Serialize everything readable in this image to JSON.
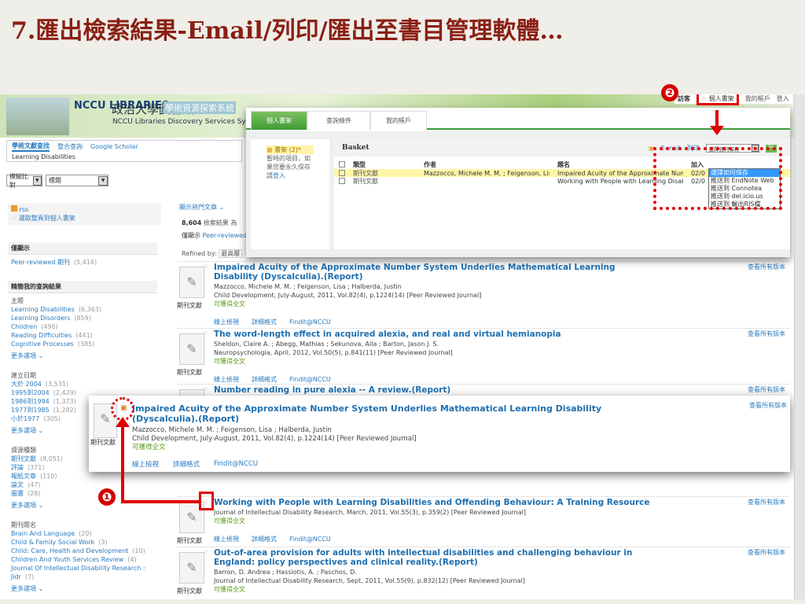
{
  "slide_title": "7.匯出檢索結果-Email/列印/匯出至書目管理軟體…",
  "header": {
    "logo": "NCCU LIBRARIES",
    "title_zh": "政治大學圖書館",
    "title_tag": "學術資源探索系統",
    "title_en": "NCCU Libraries Discovery Services System",
    "user_label": "訪客",
    "basket_link": "個人書架",
    "account_link": "我的帳戶",
    "login_link": "登入"
  },
  "search": {
    "tabs": [
      "學術文獻查找",
      "整合查詢",
      "Google Scholar"
    ],
    "query": "Learning Disabilities",
    "match_select": "模糊比對",
    "field_select": "標題"
  },
  "sidebar": {
    "rss": "rss",
    "save_page": "選取整頁到個人書架",
    "only_show_heading": "僅顯示",
    "peer_reviewed": {
      "label": "Peer-reviewed 期刊",
      "count": "(5,416)"
    },
    "refine_heading": "精簡我的查詢結果",
    "groups": [
      {
        "title": "主題",
        "items": [
          {
            "label": "Learning Disabilities",
            "count": "(6,363)"
          },
          {
            "label": "Learning Disorders",
            "count": "(859)"
          },
          {
            "label": "Children",
            "count": "(490)"
          },
          {
            "label": "Reading Difficulties",
            "count": "(441)"
          },
          {
            "label": "Cognitive Processes",
            "count": "(385)"
          }
        ],
        "more": "更多選項 ⌄"
      },
      {
        "title": "建立日期",
        "items": [
          {
            "label": "大於 2004",
            "count": "(3,531)"
          },
          {
            "label": "1995到2004",
            "count": "(2,429)"
          },
          {
            "label": "1986到1994",
            "count": "(1,373)"
          },
          {
            "label": "1977到1985",
            "count": "(1,282)"
          },
          {
            "label": "小於1977",
            "count": "(305)"
          }
        ],
        "more": "更多選項 ⌄"
      },
      {
        "title": "資源種類",
        "items": [
          {
            "label": "期刊文獻",
            "count": "(8,051)"
          },
          {
            "label": "評論",
            "count": "(371)"
          },
          {
            "label": "報紙文章",
            "count": "(110)"
          },
          {
            "label": "論文",
            "count": "(47)"
          },
          {
            "label": "圖書",
            "count": "(28)"
          }
        ],
        "more": "更多選項 ⌄"
      },
      {
        "title": "期刊題名",
        "items": [
          {
            "label": "Brain And Language",
            "count": "(20)"
          },
          {
            "label": "Child & Family Social Work",
            "count": "(3)"
          },
          {
            "label": "Child: Care, Health and Development",
            "count": "(10)"
          },
          {
            "label": "Children And Youth Services Review",
            "count": "(4)"
          },
          {
            "label": "Journal Of Intellectual Disability Research : Jidr",
            "count": "(7)"
          }
        ],
        "more": "更多選項 ⌄"
      }
    ]
  },
  "results_header": {
    "popular": "顯示熱門文章 ⌄",
    "count": "8,604",
    "count_label": "檢索結果 為",
    "only_show": "僅顯示",
    "peer": "Peer-reviewed",
    "refined_by": "Refined by:",
    "refined_value": "最高層"
  },
  "type_label": "期刊文獻",
  "fulltext": "可獲得全文",
  "actions": [
    "線上檢視",
    "詳細格式",
    "Findit@NCCU"
  ],
  "all_versions": "查看所有版本",
  "results": [
    {
      "title": "Impaired Acuity of the Approximate Number System Underlies Mathematical Learning Disability (Dyscalculia).(Report)",
      "authors": "Mazzocco, Michele M. M. ; Feigenson, Lisa ; Halberda, Justin",
      "source": "Child Development, July-August, 2011, Vol.82(4), p.1224(14) [Peer Reviewed Journal]"
    },
    {
      "title": "The word-length effect in acquired alexia, and real and virtual hemianopia",
      "authors": "Sheldon, Claire A. ; Abegg, Mathias ; Sekunova, Alla ; Barton, Jason J. S.",
      "source": "Neuropsychologia, April, 2012, Vol.50(5), p.841(11) [Peer Reviewed Journal]"
    },
    {
      "title": "Number reading in pure alexia -- A review.(Report)"
    },
    {
      "title": "Working with People with Learning Disabilities and Offending Behaviour: A Training Resource",
      "source": "Journal of Intellectual Disability Research, March, 2011, Vol.55(3), p.359(2) [Peer Reviewed Journal]"
    },
    {
      "title": "Out-of-area provision for adults with intellectual disabilities and challenging behaviour in England: policy perspectives and clinical reality.(Report)",
      "authors": "Barron, D. Andrea ; Hassiotis, A. ; Paschos, D.",
      "source": "Journal of Intellectual Disability Research, Sept, 2011, Vol.55(9), p.832(12) [Peer Reviewed Journal]"
    }
  ],
  "basket": {
    "tabs": [
      "個人書架",
      "查詢條件",
      "我的帳戶"
    ],
    "folder": "書架 (2)*",
    "note": "暫時的項目，如果您要永久保存請",
    "login": "登入",
    "heading": "Basket",
    "email": "E-mail",
    "print": "列印",
    "save_select": "選擇如何保存",
    "go": "Go",
    "columns": [
      "類型",
      "作者",
      "題名",
      "加入"
    ],
    "rows": [
      {
        "type": "期刊文獻",
        "author": "Mazzocco, Michele M. M. ; Feigenson, Lisa ;...",
        "title": "Impaired Acuity of the Approximate Numb...",
        "date": "02/0"
      },
      {
        "type": "期刊文獻",
        "author": "",
        "title": "Working with People with Learning Disabili...",
        "date": "02/0"
      }
    ],
    "options": [
      "選擇如何保存",
      "推送到 EndNote Web",
      "推送到 Connotea",
      "推送到 del.icio.us",
      "推送到 輸出RIS檔"
    ]
  },
  "annotations": {
    "step1": "❶",
    "step2": "❷"
  }
}
